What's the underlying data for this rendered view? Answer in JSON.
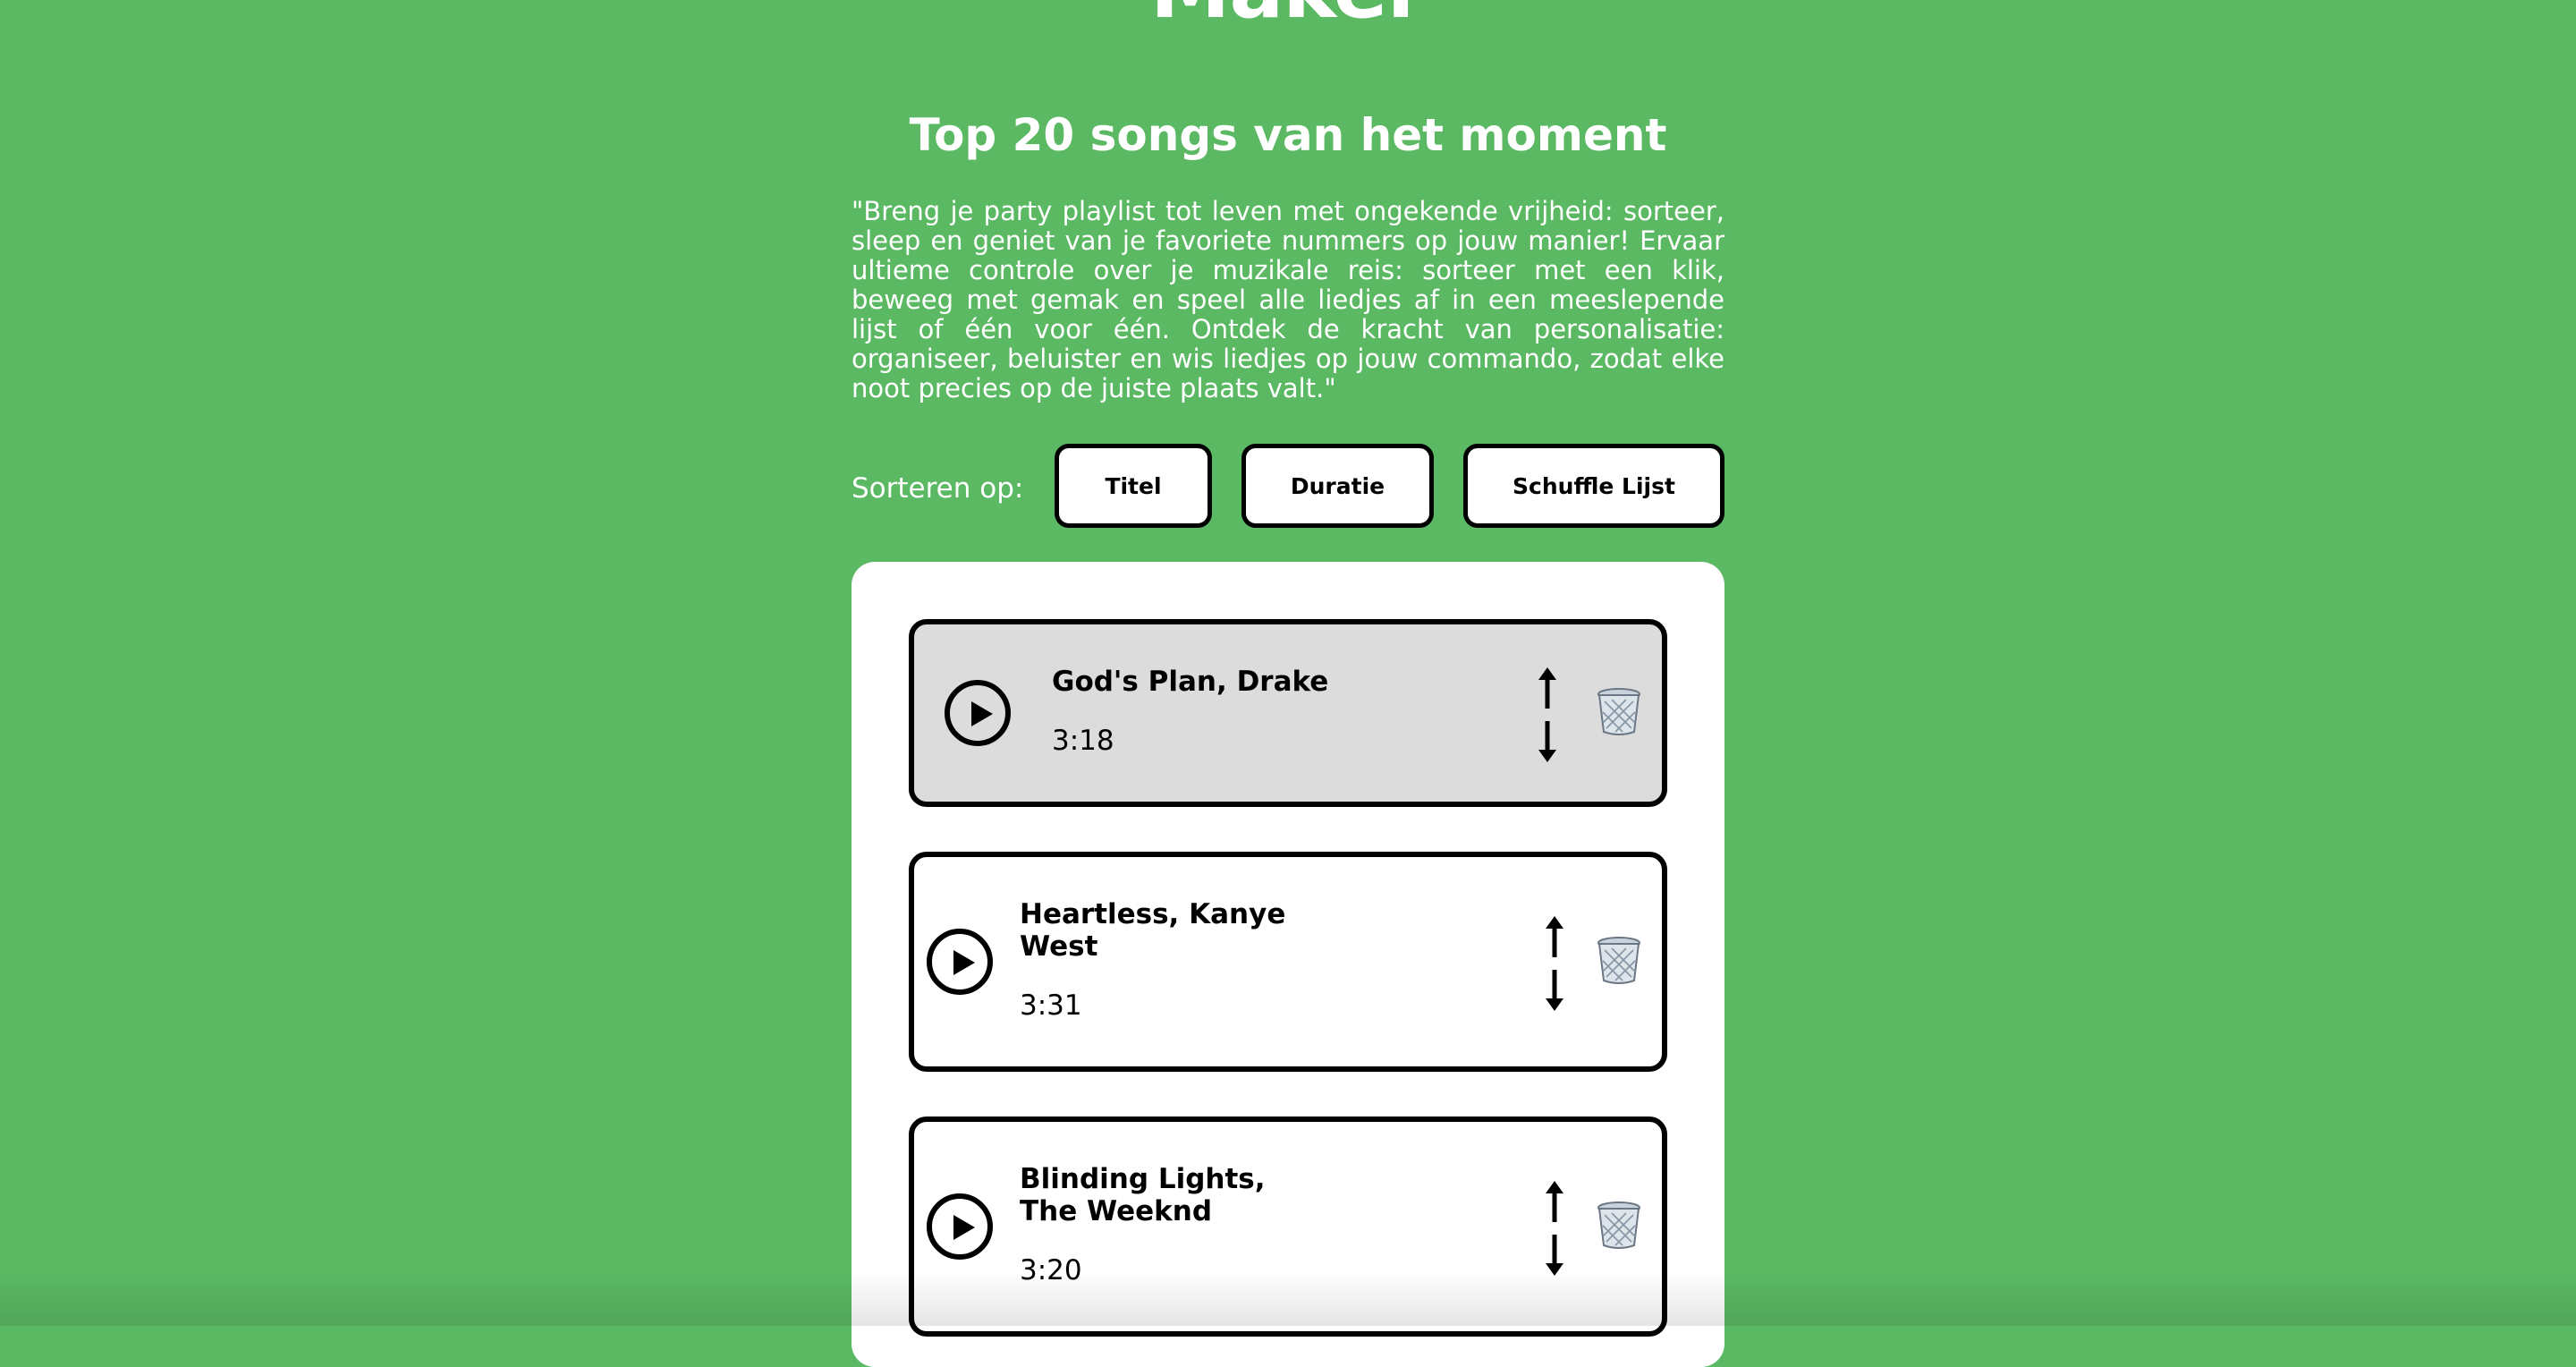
{
  "app": {
    "title": "Maker"
  },
  "header": {
    "title": "Top 20 songs van het moment",
    "intro": "\"Breng je party playlist tot leven met ongekende vrijheid: sorteer, sleep en geniet van je favoriete nummers op jouw manier! Ervaar ultieme controle over je muzikale reis: sorteer met een klik, beweeg met gemak en speel alle liedjes af in een meeslepende lijst of één voor één. Ontdek de kracht van personalisatie: organiseer, beluister en wis liedjes op jouw commando, zodat elke noot precies op de juiste plaats valt.\""
  },
  "sort": {
    "label": "Sorteren op:",
    "title_label": "Titel",
    "duration_label": "Duratie",
    "shuffle_label": "Schuffle Lijst"
  },
  "songs": [
    {
      "title": "God's Plan, Drake",
      "duration": "3:18",
      "active": true
    },
    {
      "title": "Heartless, Kanye West",
      "duration": "3:31",
      "active": false
    },
    {
      "title": "Blinding Lights, The Weeknd",
      "duration": "3:20",
      "active": false
    }
  ],
  "icons": {
    "play": "play-icon",
    "move": "up-down-arrows-icon",
    "delete": "wastebasket-icon"
  },
  "colors": {
    "background": "#5bb963",
    "panel": "#ffffff",
    "active_card": "#dcdcdc",
    "border": "#000000",
    "text_light": "#ffffff"
  }
}
